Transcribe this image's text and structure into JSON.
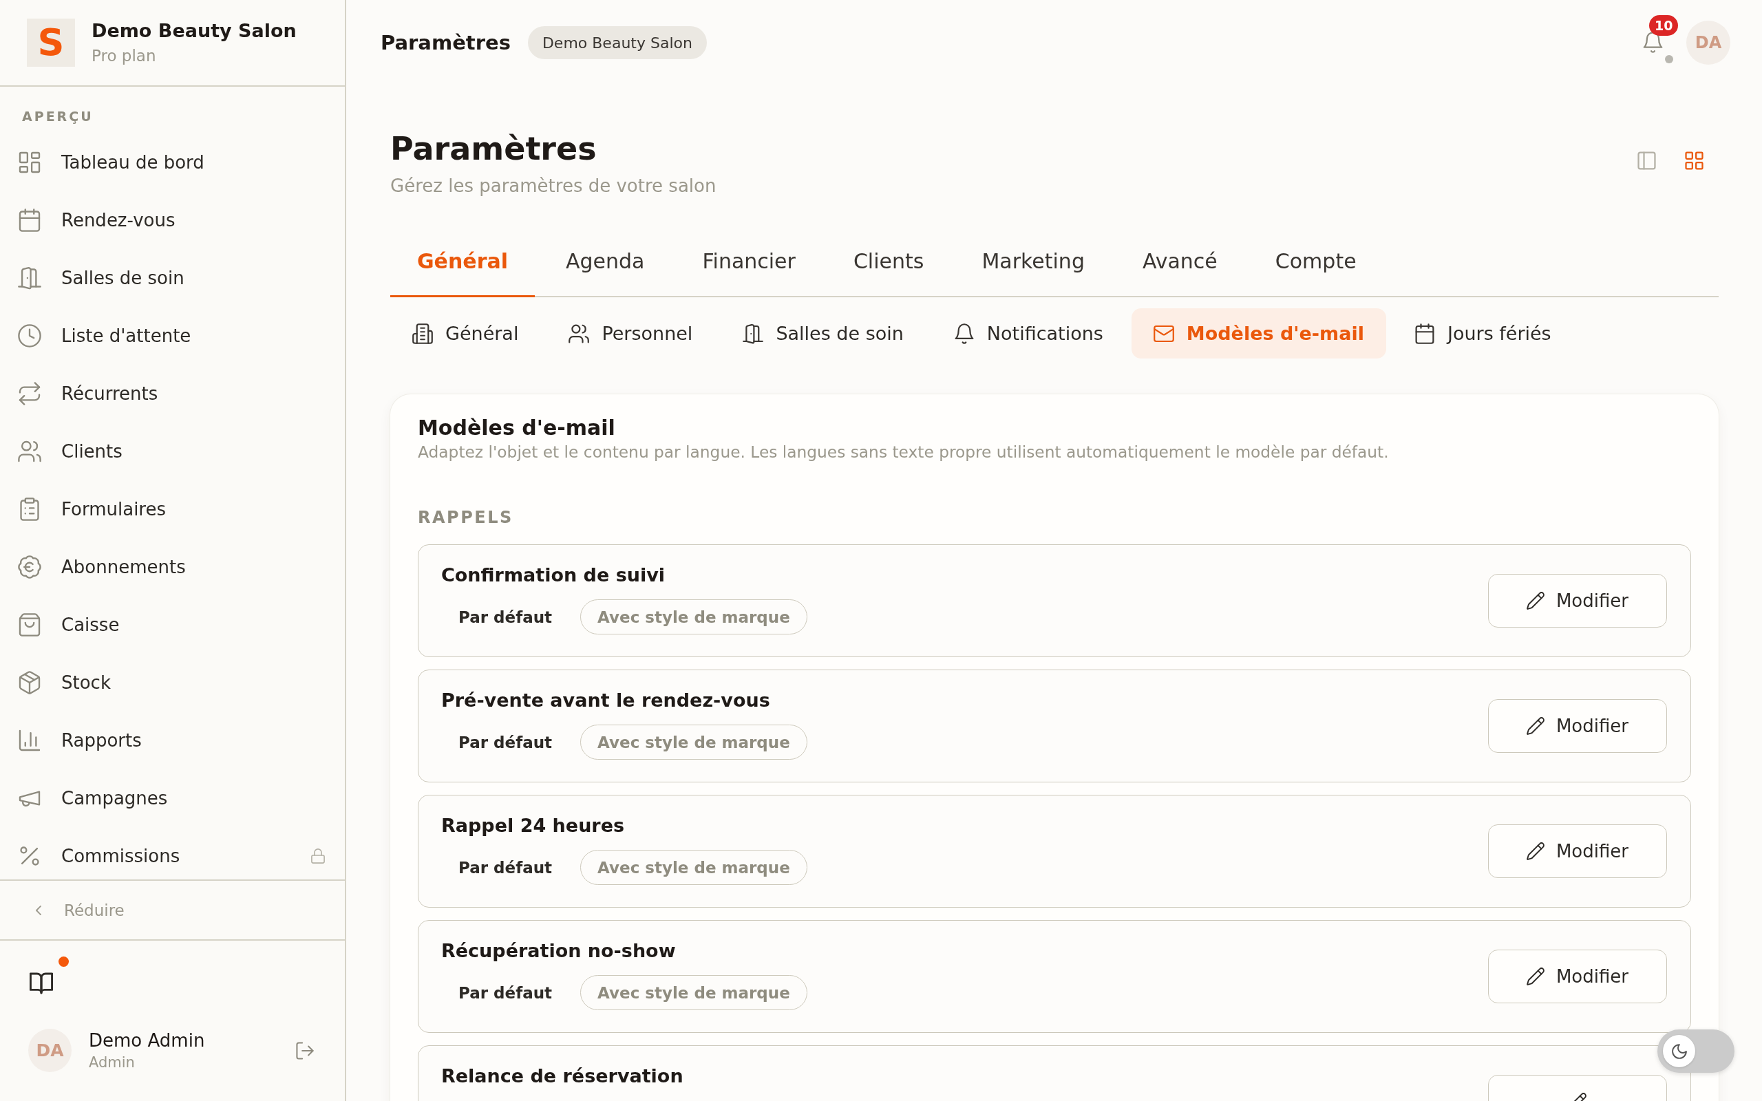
{
  "sidebar": {
    "brand": {
      "logo_letter": "S",
      "name": "Demo Beauty Salon",
      "plan": "Pro plan"
    },
    "section_label": "APERÇU",
    "items": [
      {
        "label": "Tableau de bord",
        "selected": false,
        "locked": false
      },
      {
        "label": "Rendez-vous",
        "selected": false,
        "locked": false
      },
      {
        "label": "Salles de soin",
        "selected": false,
        "locked": false
      },
      {
        "label": "Liste d'attente",
        "selected": false,
        "locked": false
      },
      {
        "label": "Récurrents",
        "selected": false,
        "locked": false
      },
      {
        "label": "Clients",
        "selected": false,
        "locked": false
      },
      {
        "label": "Formulaires",
        "selected": false,
        "locked": false
      },
      {
        "label": "Abonnements",
        "selected": false,
        "locked": false
      },
      {
        "label": "Caisse",
        "selected": false,
        "locked": false
      },
      {
        "label": "Stock",
        "selected": false,
        "locked": false
      },
      {
        "label": "Rapports",
        "selected": false,
        "locked": false
      },
      {
        "label": "Campagnes",
        "selected": false,
        "locked": false
      },
      {
        "label": "Commissions",
        "selected": false,
        "locked": true
      }
    ],
    "collapse": "Réduire",
    "guide": {
      "new": true
    },
    "user": {
      "initials": "DA",
      "name": "Demo Admin",
      "role": "Admin"
    }
  },
  "header": {
    "title": "Paramètres",
    "salon": "Demo Beauty Salon",
    "notifications": {
      "count": "10"
    },
    "avatar_initials": "DA"
  },
  "page": {
    "title": "Paramètres",
    "subtitle": "Gérez les paramètres de votre salon",
    "view_modes": [
      {
        "selected": false
      },
      {
        "selected": true
      }
    ]
  },
  "tabs": [
    {
      "label": "Général",
      "selected": true
    },
    {
      "label": "Agenda",
      "selected": false
    },
    {
      "label": "Financier",
      "selected": false
    },
    {
      "label": "Clients",
      "selected": false
    },
    {
      "label": "Marketing",
      "selected": false
    },
    {
      "label": "Avancé",
      "selected": false
    },
    {
      "label": "Compte",
      "selected": false
    }
  ],
  "subtabs": [
    {
      "label": "Général",
      "selected": false
    },
    {
      "label": "Personnel",
      "selected": false
    },
    {
      "label": "Salles de soin",
      "selected": false
    },
    {
      "label": "Notifications",
      "selected": false
    },
    {
      "label": "Modèles d'e-mail",
      "selected": true
    },
    {
      "label": "Jours fériés",
      "selected": false
    }
  ],
  "card": {
    "title": "Modèles d'e-mail",
    "description": "Adaptez l'objet et le contenu par langue. Les langues sans texte propre utilisent automatiquement le modèle par défaut.",
    "section": "RAPPELS",
    "rows": [
      {
        "title": "Confirmation de suivi",
        "tags": [
          {
            "label": "Par défaut",
            "kind": "plain"
          },
          {
            "label": "Avec style de marque",
            "kind": "outlined"
          }
        ],
        "action": "Modifier"
      },
      {
        "title": "Pré-vente avant le rendez-vous",
        "tags": [
          {
            "label": "Par défaut",
            "kind": "plain"
          },
          {
            "label": "Avec style de marque",
            "kind": "outlined"
          }
        ],
        "action": "Modifier"
      },
      {
        "title": "Rappel 24 heures",
        "tags": [
          {
            "label": "Par défaut",
            "kind": "plain"
          },
          {
            "label": "Avec style de marque",
            "kind": "outlined"
          }
        ],
        "action": "Modifier"
      },
      {
        "title": "Récupération no-show",
        "tags": [
          {
            "label": "Par défaut",
            "kind": "plain"
          },
          {
            "label": "Avec style de marque",
            "kind": "outlined"
          }
        ],
        "action": "Modifier"
      },
      {
        "title": "Relance de réservation"
      }
    ]
  },
  "dark_mode": {
    "on": false
  }
}
